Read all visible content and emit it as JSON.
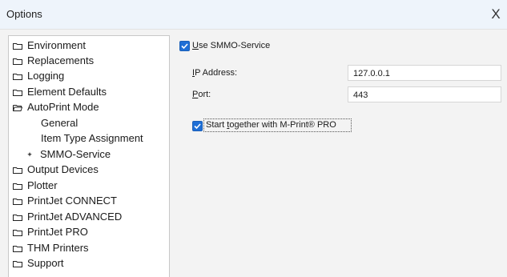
{
  "window": {
    "title": "Options",
    "close_glyph": "X"
  },
  "tree": {
    "items": [
      {
        "label": "Environment",
        "icon": "folder-icon"
      },
      {
        "label": "Replacements",
        "icon": "folder-icon"
      },
      {
        "label": "Logging",
        "icon": "folder-icon"
      },
      {
        "label": "Element Defaults",
        "icon": "folder-icon"
      },
      {
        "label": "AutoPrint Mode",
        "icon": "folder-open-icon"
      },
      {
        "label": "General",
        "icon": ""
      },
      {
        "label": "Item Type Assignment",
        "icon": ""
      },
      {
        "label": "SMMO-Service",
        "icon": "bullet-icon",
        "selected": true
      },
      {
        "label": "Output Devices",
        "icon": "folder-icon"
      },
      {
        "label": "Plotter",
        "icon": "folder-icon"
      },
      {
        "label": "PrintJet CONNECT",
        "icon": "folder-icon"
      },
      {
        "label": "PrintJet ADVANCED",
        "icon": "folder-icon"
      },
      {
        "label": "PrintJet PRO",
        "icon": "folder-icon"
      },
      {
        "label": "THM Printers",
        "icon": "folder-icon"
      },
      {
        "label": "Support",
        "icon": "folder-icon"
      }
    ],
    "bullet_glyph": "✦"
  },
  "panel": {
    "use_service": {
      "label_prefix": "U",
      "label_rest": "se SMMO-Service",
      "checked": true
    },
    "ip": {
      "label_prefix": "I",
      "label_rest": "P Address:",
      "value": "127.0.0.1"
    },
    "port": {
      "label_prefix": "P",
      "label_rest": "ort:",
      "value": "443"
    },
    "start_together": {
      "label_start": "Start ",
      "label_prefix": "t",
      "label_rest": "ogether with M-Print® PRO",
      "checked": true
    }
  },
  "colors": {
    "checkbox_accent": "#1f6fd6",
    "titlebar": "#eef4fb",
    "panel_bg": "#f3f3f3"
  }
}
